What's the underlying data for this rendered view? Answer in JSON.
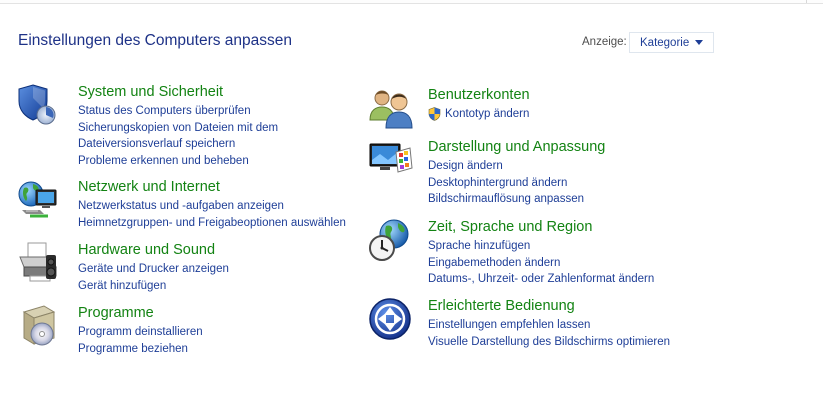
{
  "header": {
    "title": "Einstellungen des Computers anpassen",
    "view_label": "Anzeige:",
    "view_value": "Kategorie"
  },
  "left_column": [
    {
      "title": "System und Sicherheit",
      "icon": "shield-icon",
      "links": [
        "Status des Computers überprüfen",
        "Sicherungskopien von Dateien mit dem",
        "Dateiversionsverlauf speichern",
        "Probleme erkennen und beheben"
      ]
    },
    {
      "title": "Netzwerk und Internet",
      "icon": "network-globe-icon",
      "links": [
        "Netzwerkstatus und -aufgaben anzeigen",
        "Heimnetzgruppen- und Freigabeoptionen auswählen"
      ]
    },
    {
      "title": "Hardware und Sound",
      "icon": "printer-speaker-icon",
      "links": [
        "Geräte und Drucker anzeigen",
        "Gerät hinzufügen"
      ]
    },
    {
      "title": "Programme",
      "icon": "programs-box-icon",
      "links": [
        "Programm deinstallieren",
        "Programme beziehen"
      ]
    }
  ],
  "right_column": [
    {
      "title": "Benutzerkonten",
      "icon": "user-accounts-icon",
      "links": [
        "Kontotyp ändern"
      ]
    },
    {
      "title": "Darstellung und Anpassung",
      "icon": "monitor-palette-icon",
      "links": [
        "Design ändern",
        "Desktophintergrund ändern",
        "Bildschirmauflösung anpassen"
      ]
    },
    {
      "title": "Zeit, Sprache und Region",
      "icon": "clock-globe-icon",
      "links": [
        "Sprache hinzufügen",
        "Eingabemethoden ändern",
        "Datums-, Uhrzeit- oder Zahlenformat ändern"
      ]
    },
    {
      "title": "Erleichterte Bedienung",
      "icon": "ease-of-access-icon",
      "links": [
        "Einstellungen empfehlen lassen",
        "Visuelle Darstellung des Bildschirms optimieren"
      ]
    }
  ]
}
